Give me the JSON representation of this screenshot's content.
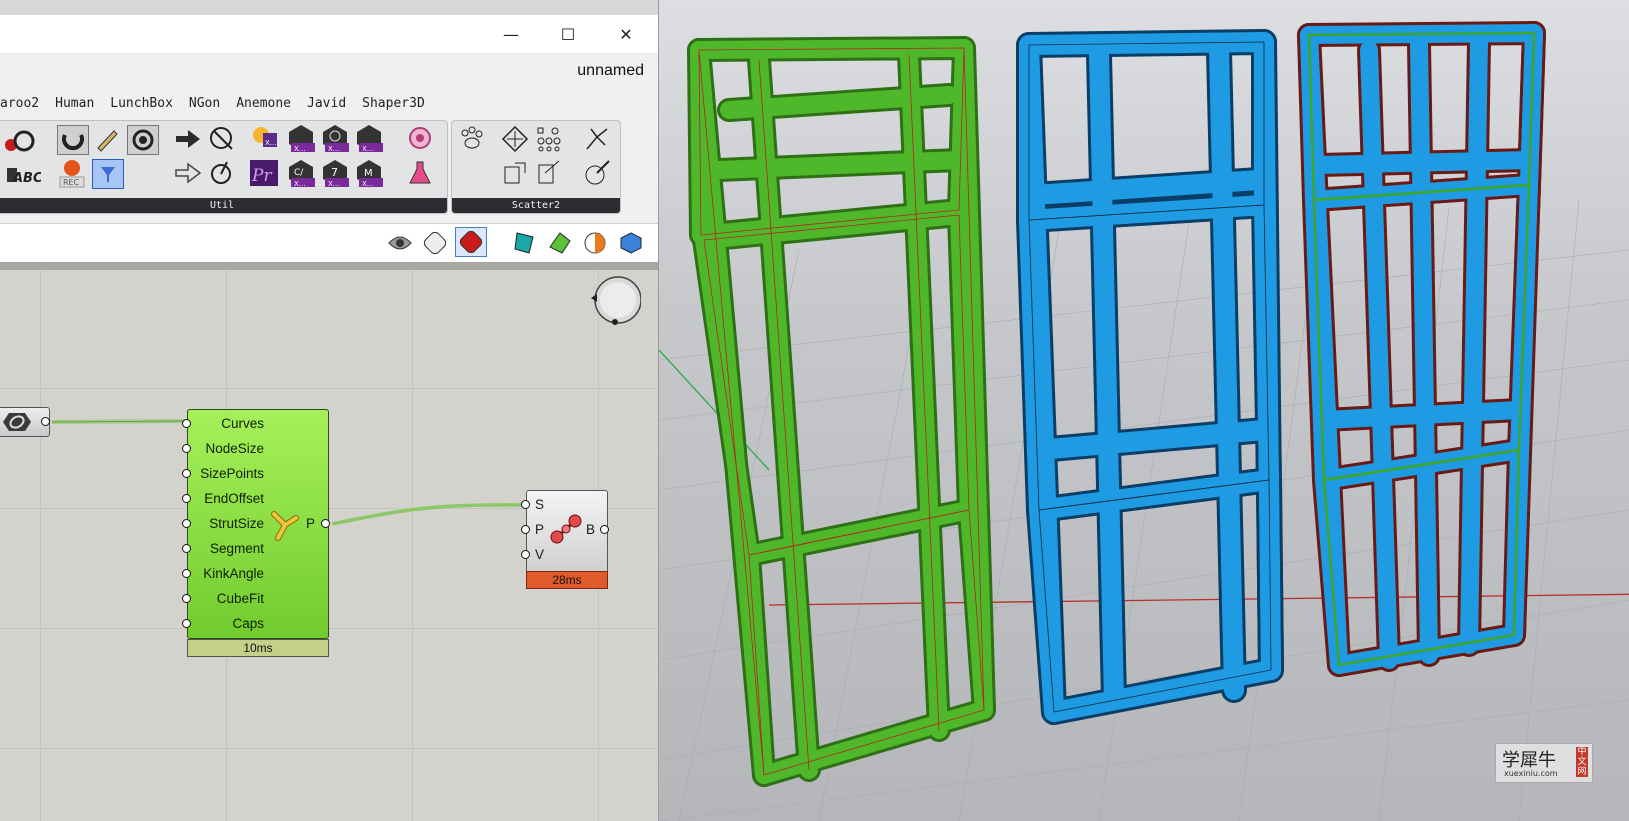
{
  "window": {
    "min_glyph": "—",
    "max_glyph": "☐",
    "close_glyph": "✕",
    "document_name": "unnamed"
  },
  "menu": {
    "items": [
      "aroo2",
      "Human",
      "LunchBox",
      "NGon",
      "Anemone",
      "Javid",
      "Shaper3D"
    ]
  },
  "ribbon": {
    "panels": [
      {
        "label": "Util"
      },
      {
        "label": "Scatter2"
      }
    ],
    "tool_badges": [
      "X...",
      "X...",
      "X...",
      "X...",
      "X...",
      "X...",
      "X..."
    ],
    "small_labels": {
      "rec": "REC",
      "abc": "ABC",
      "pr": "Pr",
      "c": "C/",
      "seven": "7",
      "m": "M"
    }
  },
  "component": {
    "inputs": [
      "Curves",
      "NodeSize",
      "SizePoints",
      "EndOffset",
      "StrutSize",
      "Segment",
      "KinkAngle",
      "CubeFit",
      "Caps"
    ],
    "output": "P",
    "time": "10ms"
  },
  "component2": {
    "inputs": [
      "S",
      "P",
      "V"
    ],
    "output": "B",
    "time": "28ms"
  },
  "viewport": {
    "watermark_cn": "学犀牛",
    "watermark_url": "xuexiniu.com",
    "watermark_tag": "中文网"
  },
  "colors": {
    "green_frame": "#4fb82a",
    "blue_frame": "#1e9be3",
    "accent_red": "#c0392b"
  }
}
